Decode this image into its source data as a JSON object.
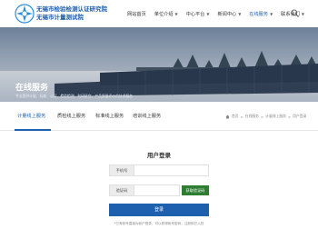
{
  "header": {
    "logo_line1": "无锡市检验检测认证研究院",
    "logo_line2": "无锡市计量测试院",
    "nav": [
      {
        "label": "网站首页",
        "dropdown": false
      },
      {
        "label": "单位介绍",
        "dropdown": true
      },
      {
        "label": "中心平台",
        "dropdown": true
      },
      {
        "label": "新闻中心",
        "dropdown": true
      },
      {
        "label": "在线服务",
        "dropdown": true
      },
      {
        "label": "联系我们",
        "dropdown": true
      }
    ],
    "active_nav": "在线服务",
    "accent": "#1e5fae"
  },
  "banner": {
    "title": "在线服务",
    "subtitle": "专业提供计量、标准、认证、检验检测、科研研究、产品质量评价的技术服务"
  },
  "tabs": [
    {
      "label": "计量线上服务",
      "active": true
    },
    {
      "label": "质检线上服务",
      "active": false
    },
    {
      "label": "标准线上服务",
      "active": false
    },
    {
      "label": "培训线上服务",
      "active": false
    }
  ],
  "breadcrumb": [
    "首页",
    "在线服务",
    "计量线上服务",
    "用户登录"
  ],
  "login": {
    "title": "用户登录",
    "phone_label": "手机号",
    "phone_value": "",
    "code_label": "验证码",
    "code_value": "",
    "get_code_label": "获取验证码",
    "submit_label": "登录",
    "hint": "*已有帐号直接为帐户登录，可以获得帐号密码，注册即已入驻"
  }
}
